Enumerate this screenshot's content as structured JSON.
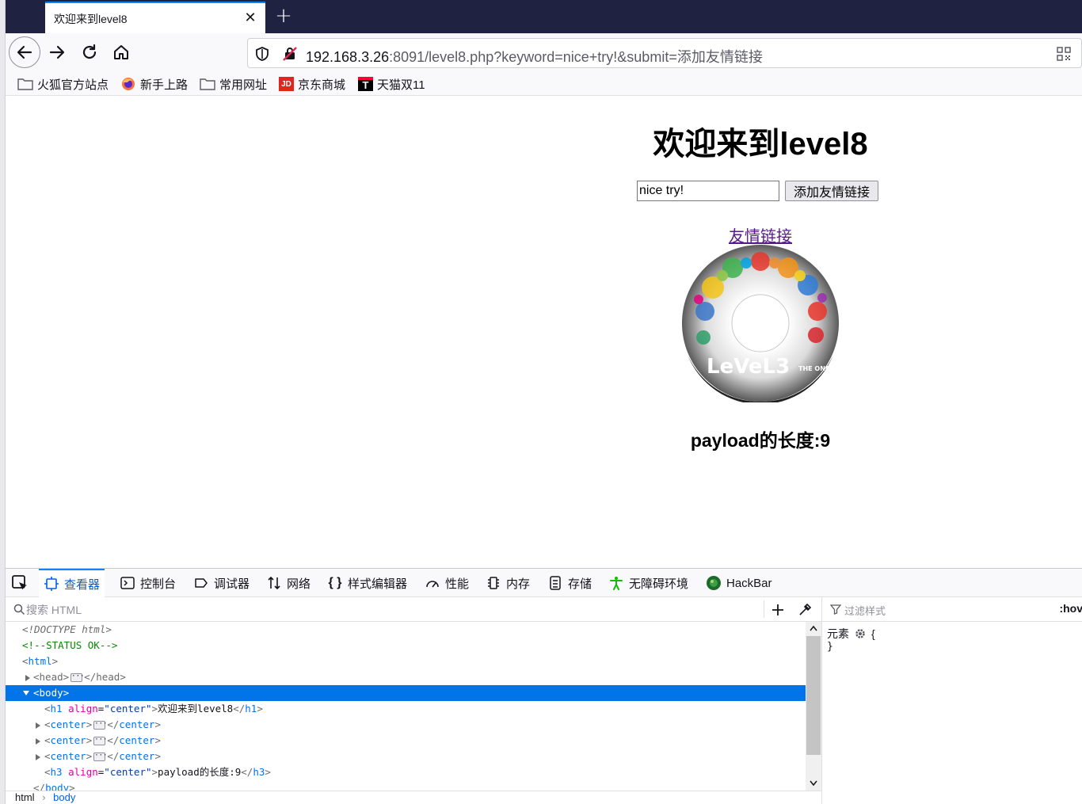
{
  "browser": {
    "tab_title": "欢迎来到level8",
    "tab_close": "✕",
    "newtab": "+",
    "url_host": "192.168.3.26",
    "url_rest": ":8091/level8.php?keyword=nice+try!&submit=添加友情链接"
  },
  "bookmarks": [
    {
      "label": "火狐官方站点",
      "icon": "folder-icon"
    },
    {
      "label": "新手上路",
      "icon": "firefox-icon"
    },
    {
      "label": "常用网址",
      "icon": "folder-icon"
    },
    {
      "label": "京东商城",
      "icon": "jd-icon",
      "badge": "JD"
    },
    {
      "label": "天猫双11",
      "icon": "tmall-icon",
      "badge": "T"
    }
  ],
  "page": {
    "heading": "欢迎来到level8",
    "keyword_value": "nice try!",
    "submit_label": "添加友情链接",
    "friend_link": "友情链接",
    "payload_text": "payload的长度:9",
    "disc_text": "LeVeL3",
    "disc_sub": "THE ONE"
  },
  "devtools": {
    "tabs": [
      {
        "label": "查看器",
        "icon": "inspector-icon"
      },
      {
        "label": "控制台",
        "icon": "console-icon"
      },
      {
        "label": "调试器",
        "icon": "debugger-icon"
      },
      {
        "label": "网络",
        "icon": "network-icon"
      },
      {
        "label": "样式编辑器",
        "icon": "style-editor-icon"
      },
      {
        "label": "性能",
        "icon": "performance-icon"
      },
      {
        "label": "内存",
        "icon": "memory-icon"
      },
      {
        "label": "存储",
        "icon": "storage-icon"
      },
      {
        "label": "无障碍环境",
        "icon": "accessibility-icon"
      },
      {
        "label": "HackBar",
        "icon": "hackbar-icon"
      }
    ],
    "search_placeholder": "搜索 HTML",
    "filter_placeholder": "过滤样式",
    "hov": ":hov",
    "markup": {
      "doctype": "<!DOCTYPE html>",
      "comment": "<!--STATUS OK-->",
      "html": "html",
      "head": "head",
      "body": "body",
      "h1_tag": "h1",
      "h1_attr": "align",
      "h1_val": "\"center\"",
      "h1_text": "欢迎来到level8",
      "center": "center",
      "h3_tag": "h3",
      "h3_attr": "align",
      "h3_val": "\"center\"",
      "h3_text": "payload的长度:9"
    },
    "rule_selector": "元素",
    "rule_open": "{",
    "rule_close": "}",
    "crumb_html": "html",
    "crumb_body": "body"
  }
}
